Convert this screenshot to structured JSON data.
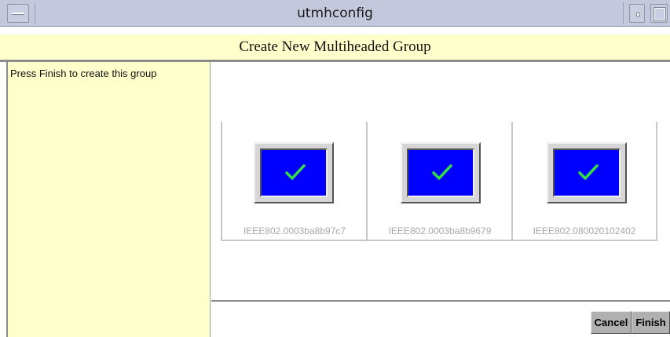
{
  "window": {
    "title": "utmhconfig"
  },
  "header": {
    "title": "Create New Multiheaded Group"
  },
  "info_panel": {
    "text": "Press Finish to create this group"
  },
  "devices": [
    {
      "label": "IEEE802.0003ba8b97c7",
      "icon": "check-icon",
      "selected": true
    },
    {
      "label": "IEEE802.0003ba8b9679",
      "icon": "check-icon",
      "selected": true
    },
    {
      "label": "IEEE802.080020102402",
      "icon": "check-icon",
      "selected": true
    }
  ],
  "buttons": {
    "cancel_label": "Cancel",
    "finish_label": "Finish"
  },
  "colors": {
    "title_bar": "#c3c8dc",
    "panel_background": "#ffffcc",
    "screen_blue": "#0000ff",
    "check_green": "#33dd44",
    "label_gray": "#a8a8a8"
  }
}
